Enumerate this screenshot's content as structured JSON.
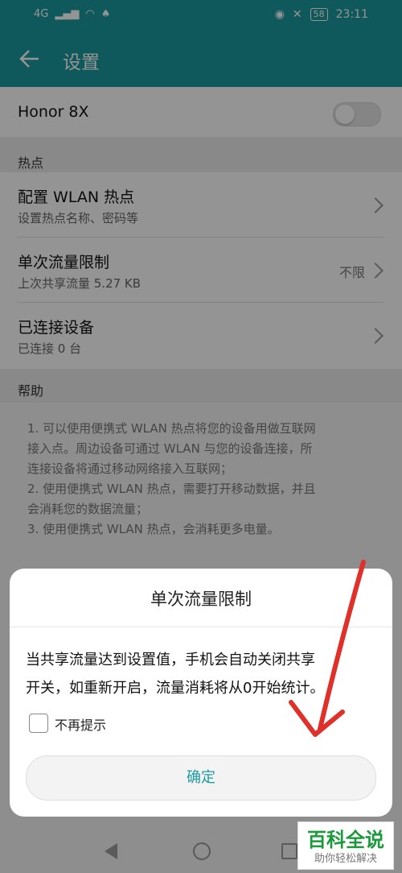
{
  "status": {
    "network": "4G",
    "time": "23:11",
    "battery": "58"
  },
  "appbar": {
    "title": "设置"
  },
  "device": {
    "name": "Honor 8X"
  },
  "sections": {
    "hotspot": "热点",
    "help": "帮助"
  },
  "items": [
    {
      "title": "配置 WLAN 热点",
      "subtitle": "设置热点名称、密码等",
      "value": ""
    },
    {
      "title": "单次流量限制",
      "subtitle": "上次共享流量 5.27 KB",
      "value": "不限"
    },
    {
      "title": "已连接设备",
      "subtitle": "已连接 0 台",
      "value": ""
    }
  ],
  "help_lines": [
    "1. 可以使用便携式 WLAN 热点将您的设备用做互联网",
    "接入点。周边设备可通过 WLAN 与您的设备连接，所",
    "连接设备将通过移动网络接入互联网；",
    "2. 使用便携式 WLAN 热点，需要打开移动数据，并且",
    "会消耗您的数据流量；",
    "3. 使用便携式 WLAN 热点，会消耗更多电量。"
  ],
  "dialog": {
    "title": "单次流量限制",
    "message_line1": "当共享流量达到设置值，手机会自动关闭共享",
    "message_line2": "开关，如重新开启，流量消耗将从0开始统计。",
    "checkbox_label": "不再提示",
    "ok_label": "确定"
  },
  "watermark": {
    "main": "百科全说",
    "sub": "助你轻松解决"
  },
  "colors": {
    "accent": "#1b9aa0",
    "annotation": "#e0302a"
  }
}
